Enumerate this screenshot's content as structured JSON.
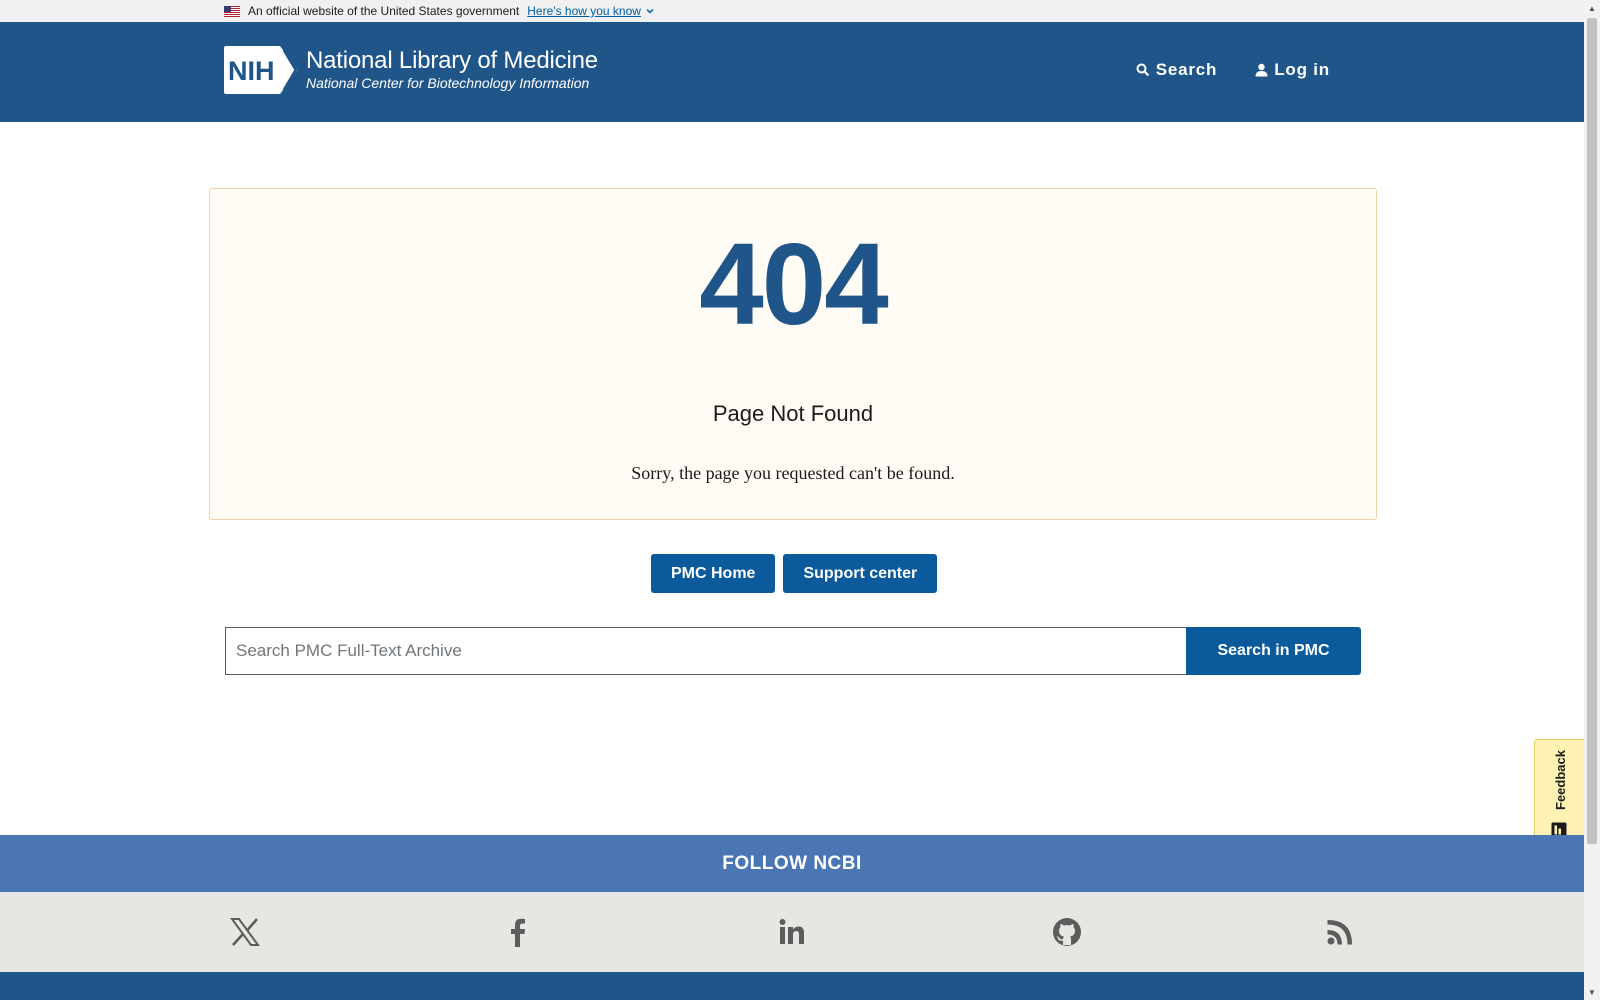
{
  "gov_banner": {
    "text": "An official website of the United States government",
    "link_label": "Here's how you know"
  },
  "header": {
    "logo_badge": "NIH",
    "logo_title": "National Library of Medicine",
    "logo_subtitle": "National Center for Biotechnology Information",
    "search_label": "Search",
    "login_label": "Log in"
  },
  "error": {
    "code": "404",
    "title": "Page Not Found",
    "message": "Sorry, the page you requested can't be found."
  },
  "actions": {
    "home_label": "PMC Home",
    "support_label": "Support center"
  },
  "search": {
    "placeholder": "Search PMC Full-Text Archive",
    "button_label": "Search in PMC"
  },
  "feedback": {
    "label": "Feedback"
  },
  "footer": {
    "follow_label": "FOLLOW NCBI",
    "social": [
      "x-icon",
      "facebook-icon",
      "linkedin-icon",
      "github-icon",
      "rss-icon"
    ]
  },
  "colors": {
    "header_bg": "#20558a",
    "accent": "#0b5a9c",
    "follow_bg": "#4a77b4",
    "error_box_bg": "#fffcf5",
    "feedback_bg": "#fff2b3"
  }
}
